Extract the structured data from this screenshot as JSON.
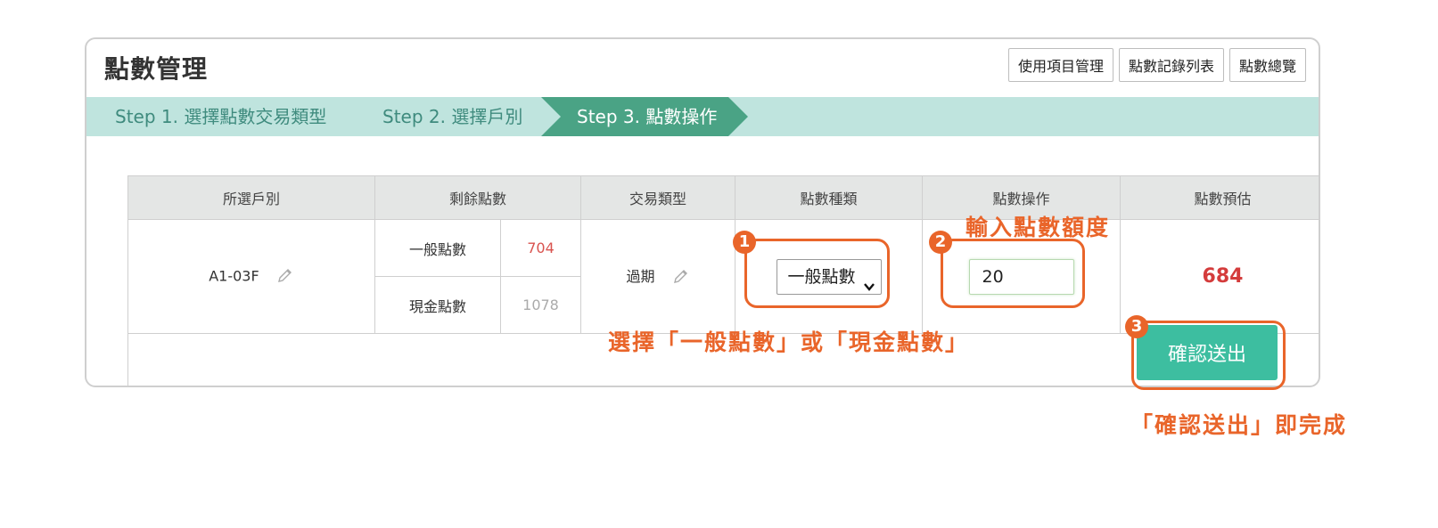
{
  "panel": {
    "title": "點數管理",
    "buttons": [
      "使用項目管理",
      "點數記錄列表",
      "點數總覽"
    ]
  },
  "steps": [
    "Step 1. 選擇點數交易類型",
    "Step 2. 選擇戶別",
    "Step 3. 點數操作"
  ],
  "table": {
    "headers": [
      "所選戶別",
      "剩餘點數",
      "交易類型",
      "點數種類",
      "點數操作",
      "點數預估"
    ],
    "household": "A1-03F",
    "balances": [
      {
        "label": "一般點數",
        "value": "704"
      },
      {
        "label": "現金點數",
        "value": "1078"
      }
    ],
    "transaction_type": "過期",
    "point_type_selected": "一般點數",
    "amount_value": "20",
    "estimate": "684"
  },
  "submit_label": "確認送出",
  "annotations": {
    "badge1": "1",
    "badge2": "2",
    "badge3": "3",
    "text_amount": "輸入點數額度",
    "text_select": "選擇「一般點數」或「現金點數」",
    "text_submit": "「確認送出」即完成"
  },
  "colors": {
    "accent": "#3dbea0",
    "annotation": "#e9652a",
    "step_active": "#4aa385",
    "step_bar": "#bfe4de"
  }
}
